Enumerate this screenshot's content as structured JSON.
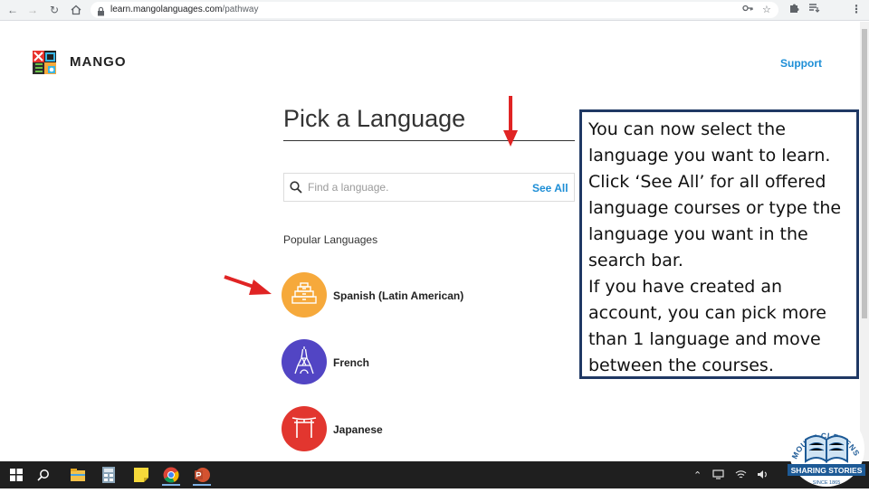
{
  "browser": {
    "url_domain": "learn.mangolanguages.com",
    "url_path": "/pathway"
  },
  "header": {
    "brand": "MANGO",
    "support_label": "Support"
  },
  "main": {
    "title": "Pick a Language",
    "search_placeholder": "Find a language.",
    "see_all_label": "See All",
    "popular_heading": "Popular Languages",
    "languages": [
      {
        "name": "Spanish (Latin American)",
        "color": "#f6a93b",
        "icon": "pyramid-icon"
      },
      {
        "name": "French",
        "color": "#5245c4",
        "icon": "eiffel-tower-icon"
      },
      {
        "name": "Japanese",
        "color": "#e2362f",
        "icon": "torii-gate-icon"
      }
    ]
  },
  "annotation": {
    "paragraph_1": "You can now select the language you want to learn. Click ‘See All’ for all offered language courses or type the language you want in the search bar.",
    "paragraph_2": "If you have created an account, you can pick more than 1 language and move between the courses."
  },
  "seal": {
    "arc_text": "MOUNT CLEMENS PUBLIC LIBRARY",
    "banner_text": "SHARING STORIES",
    "since_text": "SINCE 1865"
  },
  "colors": {
    "accent": "#1d8ed6",
    "annotation_border": "#1f3864",
    "arrow": "#e02424"
  }
}
